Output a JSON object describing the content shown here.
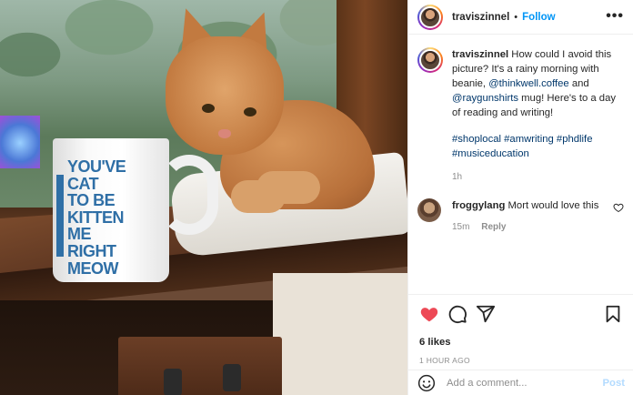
{
  "post": {
    "username": "traviszinnel",
    "follow_label": "Follow",
    "header_separator": "•",
    "more_label": "•••",
    "caption_text": "How could I avoid this picture? It's a rainy morning with beanie, ",
    "mention1": "@thinkwell.coffee",
    "caption_and": " and ",
    "mention2": "@raygunshirts",
    "caption_end": " mug! Here's to a day of reading and writing!",
    "hashtags": "#shoplocal #amwriting #phdlife #musiceducation",
    "caption_time": "1h",
    "mug_text": [
      "YOU'VE",
      "CAT",
      "TO BE",
      "KITTEN",
      "ME",
      "RIGHT",
      "MEOW"
    ]
  },
  "comments": [
    {
      "username": "froggylang",
      "text": "Mort would love this",
      "time": "15m",
      "reply_label": "Reply"
    }
  ],
  "stats": {
    "likes": "6 likes",
    "posted_ago": "1 HOUR AGO"
  },
  "compose": {
    "placeholder": "Add a comment...",
    "post_label": "Post"
  },
  "colors": {
    "accent": "#0095f6",
    "like_red": "#ed4956",
    "mug_blue": "#2f6fa6"
  },
  "icons": [
    "heart-icon",
    "comment-icon",
    "share-icon",
    "bookmark-icon",
    "emoji-icon",
    "more-icon"
  ]
}
